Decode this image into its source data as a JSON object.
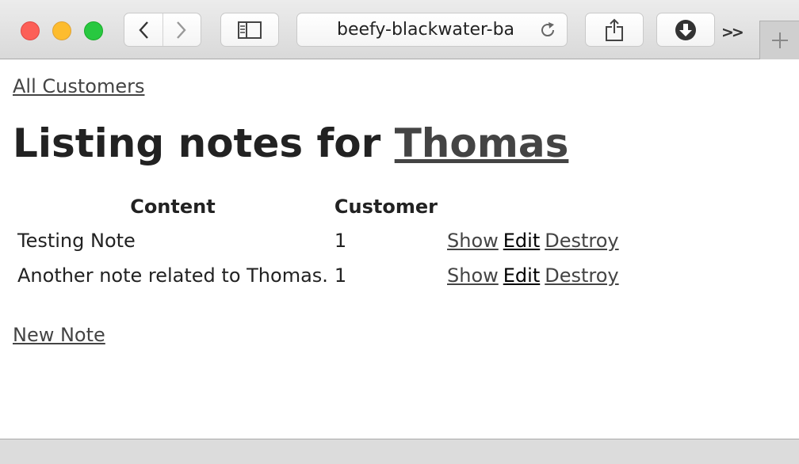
{
  "browser": {
    "url": "beefy-blackwater-ba",
    "overflow_label": ">>",
    "colors": {
      "close": "#fc5f57",
      "minimize": "#fdbc2e",
      "zoom": "#28c840"
    }
  },
  "page": {
    "back_link": "All Customers",
    "heading_prefix": "Listing notes for ",
    "heading_customer": "Thomas",
    "table": {
      "headers": [
        "Content",
        "Customer",
        ""
      ],
      "rows": [
        {
          "content": "Testing Note",
          "customer": "1",
          "show": "Show",
          "edit": "Edit",
          "destroy": "Destroy"
        },
        {
          "content": "Another note related to Thomas.",
          "customer": "1",
          "show": "Show",
          "edit": "Edit",
          "destroy": "Destroy"
        }
      ]
    },
    "new_note_link": "New Note",
    "link_color": "#444444"
  }
}
